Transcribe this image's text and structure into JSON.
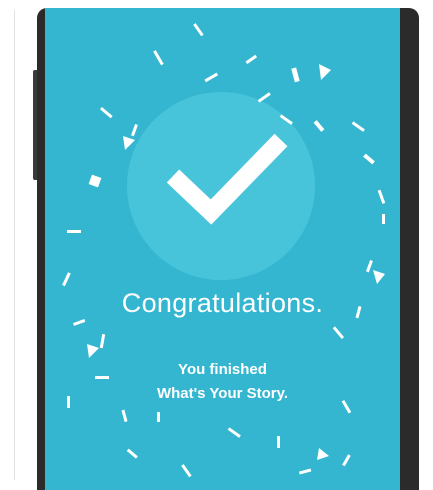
{
  "screen": {
    "background_color": "#35b6d0",
    "halo_color": "#48c4da",
    "check_icon": "checkmark-icon",
    "title": "Congratulations.",
    "message_line1": "You finished",
    "message_line2": "What's Your Story."
  }
}
